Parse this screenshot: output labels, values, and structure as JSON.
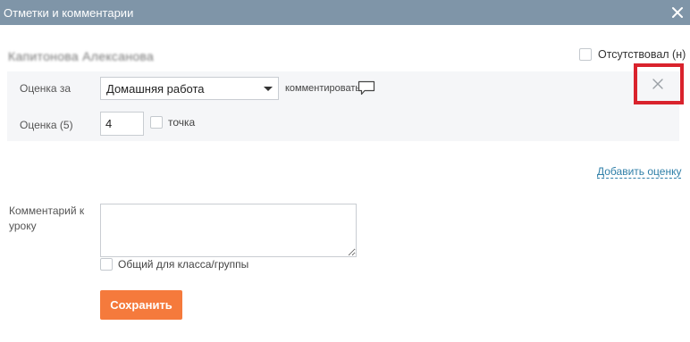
{
  "dialog": {
    "title": "Отметки и комментарии",
    "close_icon": "close-icon"
  },
  "student": {
    "name": "Капитонова Алексанова"
  },
  "absent": {
    "label": "Отсутствовал (н)",
    "checked": false
  },
  "grade_row": {
    "grade_for_label": "Оценка за",
    "work_type_selected": "Домашняя работа",
    "comment_link": "комментировать",
    "comment_icon": "speech-bubble-icon",
    "remove_icon": "close-icon",
    "highlight_color": "#d9232d"
  },
  "grade": {
    "label": "Оценка (5)",
    "value": "4",
    "point_label": "точка",
    "point_checked": false
  },
  "add_grade_link": "Добавить оценку",
  "lesson_comment": {
    "label": "Комментарий к уроку",
    "value": "",
    "common_label": "Общий для класса/группы",
    "common_checked": false
  },
  "save_button": "Сохранить",
  "colors": {
    "titlebar": "#7f95a8",
    "accent": "#f57a3c",
    "link": "#2f7fa8"
  }
}
